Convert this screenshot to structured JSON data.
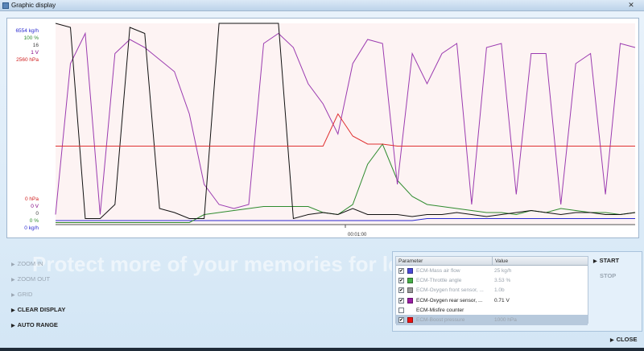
{
  "window": {
    "title": "Graphic display",
    "close_glyph": "✕"
  },
  "axes": {
    "top_labels": [
      {
        "text": "6554 kg/h",
        "color": "#2a2ad0"
      },
      {
        "text": "100 %",
        "color": "#2e8b2e"
      },
      {
        "text": "16",
        "color": "#444444"
      },
      {
        "text": "1 V",
        "color": "#800080"
      },
      {
        "text": "2560 hPa",
        "color": "#d02020"
      }
    ],
    "bottom_labels": [
      {
        "text": "0 hPa",
        "color": "#d02020"
      },
      {
        "text": "0 V",
        "color": "#800080"
      },
      {
        "text": "0",
        "color": "#444444"
      },
      {
        "text": "0 %",
        "color": "#2e8b2e"
      },
      {
        "text": "0 kg/h",
        "color": "#2a2ad0"
      }
    ],
    "time_marker": "00:01:00"
  },
  "chart_data": {
    "type": "line",
    "x_unit": "samples",
    "series": [
      {
        "name": "ECM-Mass air flow",
        "color": "#2a2ad0",
        "values": [
          2,
          2,
          2,
          2,
          2,
          2,
          2,
          2,
          2,
          2,
          2,
          2,
          2,
          2,
          2,
          2,
          2,
          2,
          2,
          2,
          2,
          2,
          2,
          2,
          2,
          3,
          3,
          3,
          3,
          3,
          3,
          3,
          3,
          3,
          3,
          3,
          3,
          3,
          3,
          3
        ]
      },
      {
        "name": "ECM-Throttle angle",
        "color": "#2e8b2e",
        "values": [
          1,
          1,
          1,
          1,
          1,
          1,
          1,
          1,
          1,
          1,
          5,
          6,
          7,
          8,
          9,
          9,
          9,
          9,
          6,
          5,
          10,
          30,
          40,
          22,
          14,
          10,
          9,
          8,
          7,
          6,
          6,
          5,
          7,
          6,
          8,
          7,
          6,
          6,
          5,
          6
        ]
      },
      {
        "name": "ECM-Oxygen rear sensor, ...",
        "color": "#9b3bb0",
        "values": [
          5,
          80,
          95,
          5,
          85,
          92,
          88,
          82,
          76,
          55,
          20,
          10,
          8,
          10,
          90,
          95,
          88,
          70,
          60,
          45,
          80,
          92,
          90,
          20,
          85,
          70,
          85,
          90,
          10,
          88,
          90,
          15,
          85,
          85,
          10,
          80,
          85,
          15,
          90,
          88
        ]
      },
      {
        "name": "ECM-Misfire counter",
        "color": "#111111",
        "values": [
          100,
          98,
          3,
          3,
          10,
          98,
          95,
          8,
          6,
          3,
          3,
          100,
          100,
          100,
          100,
          100,
          3,
          5,
          6,
          5,
          8,
          5,
          5,
          5,
          4,
          5,
          5,
          6,
          5,
          4,
          5,
          6,
          7,
          6,
          5,
          6,
          6,
          5,
          5,
          6
        ]
      },
      {
        "name": "ECM-Boost pressure",
        "color": "#e03030",
        "values": [
          39,
          39,
          39,
          39,
          39,
          39,
          39,
          39,
          39,
          39,
          39,
          39,
          39,
          39,
          39,
          39,
          39,
          39,
          39,
          55,
          44,
          40,
          40,
          39,
          39,
          39,
          39,
          39,
          39,
          39,
          39,
          39,
          39,
          39,
          39,
          39,
          39,
          39,
          39,
          39
        ]
      }
    ]
  },
  "watermark": "Protect more of your memories for less!",
  "commands": [
    {
      "label": "ZOOM IN",
      "enabled": false
    },
    {
      "label": "ZOOM OUT",
      "enabled": false
    },
    {
      "label": "GRID",
      "enabled": false
    },
    {
      "label": "CLEAR DISPLAY",
      "enabled": true
    },
    {
      "label": "AUTO RANGE",
      "enabled": true
    }
  ],
  "params": {
    "col_name": "Parameter",
    "col_value": "Value",
    "rows": [
      {
        "checked": true,
        "color": "#4a4ad8",
        "name": "ECM-Mass air flow",
        "value": "25 kg/h",
        "faded": true,
        "selected": false
      },
      {
        "checked": true,
        "color": "#48b048",
        "name": "ECM-Throttle angle",
        "value": "3.53 %",
        "faded": true,
        "selected": false
      },
      {
        "checked": true,
        "color": "#9a9a9a",
        "name": "ECM-Oxygen front sensor, ...",
        "value": "1.0b",
        "faded": true,
        "selected": false
      },
      {
        "checked": true,
        "color": "#9b1fa6",
        "name": "ECM-Oxygen rear sensor, ...",
        "value": "0.71 V",
        "faded": false,
        "selected": false
      },
      {
        "checked": false,
        "color": "",
        "name": "ECM-Misfire counter",
        "value": "",
        "faded": false,
        "selected": false
      },
      {
        "checked": true,
        "color": "#ee1111",
        "name": "ECM-Boost pressure",
        "value": "1000 hPa",
        "faded": true,
        "selected": true
      }
    ]
  },
  "actions": {
    "start": "START",
    "stop": "STOP",
    "close": "CLOSE"
  },
  "check_glyph": "✔",
  "arrow_glyph": "▶"
}
